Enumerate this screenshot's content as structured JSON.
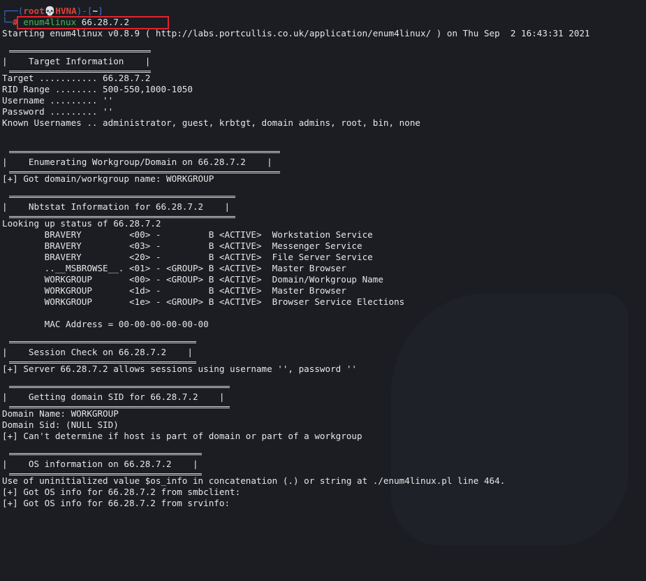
{
  "prompt": {
    "frame_top_left": "┌──(",
    "user": "root",
    "skull": "💀",
    "host": "HVNA",
    "frame_mid": ")-[",
    "dir": "~",
    "frame_end": "]",
    "frame_bottom": "└─",
    "sign": "#",
    "command": "enum4linux",
    "argument": "66.28.7.2"
  },
  "lines": {
    "starting": "Starting enum4linux v0.8.9 ( http://labs.portcullis.co.uk/application/enum4linux/ ) on Thu Sep  2 16:43:31 2021"
  },
  "sections": {
    "target": {
      "title": "|    Target Information    |",
      "rows": [
        "Target ........... 66.28.7.2",
        "RID Range ........ 500-550,1000-1050",
        "Username ......... ''",
        "Password ......... ''",
        "Known Usernames .. administrator, guest, krbtgt, domain admins, root, bin, none"
      ]
    },
    "workgroup": {
      "title": "|    Enumerating Workgroup/Domain on 66.28.7.2    |",
      "rows": [
        "[+] Got domain/workgroup name: WORKGROUP"
      ]
    },
    "nbtstat": {
      "title": "|    Nbtstat Information for 66.28.7.2    |",
      "rows": [
        "Looking up status of 66.28.7.2",
        "        BRAVERY         <00> -         B <ACTIVE>  Workstation Service",
        "        BRAVERY         <03> -         B <ACTIVE>  Messenger Service",
        "        BRAVERY         <20> -         B <ACTIVE>  File Server Service",
        "        ..__MSBROWSE__. <01> - <GROUP> B <ACTIVE>  Master Browser",
        "        WORKGROUP       <00> - <GROUP> B <ACTIVE>  Domain/Workgroup Name",
        "        WORKGROUP       <1d> -         B <ACTIVE>  Master Browser",
        "        WORKGROUP       <1e> - <GROUP> B <ACTIVE>  Browser Service Elections",
        "",
        "        MAC Address = 00-00-00-00-00-00"
      ]
    },
    "session": {
      "title": "|    Session Check on 66.28.7.2    |",
      "rows": [
        "[+] Server 66.28.7.2 allows sessions using username '', password ''"
      ]
    },
    "sid": {
      "title": "|    Getting domain SID for 66.28.7.2    |",
      "rows": [
        "Domain Name: WORKGROUP",
        "Domain Sid: (NULL SID)",
        "[+] Can't determine if host is part of domain or part of a workgroup"
      ]
    },
    "os": {
      "title": "|    OS information on 66.28.7.2    |",
      "rows": [
        "Use of uninitialized value $os_info in concatenation (.) or string at ./enum4linux.pl line 464.",
        "[+] Got OS info for 66.28.7.2 from smbclient:",
        "[+] Got OS info for 66.28.7.2 from srvinfo:"
      ]
    }
  },
  "colors": {
    "background": "#1b1d22",
    "text": "#e7e7e7",
    "prompt_frame": "#3f6fd8",
    "prompt_user": "#e0403a",
    "command": "#3dbd57",
    "highlight_box": "#e2232e"
  }
}
